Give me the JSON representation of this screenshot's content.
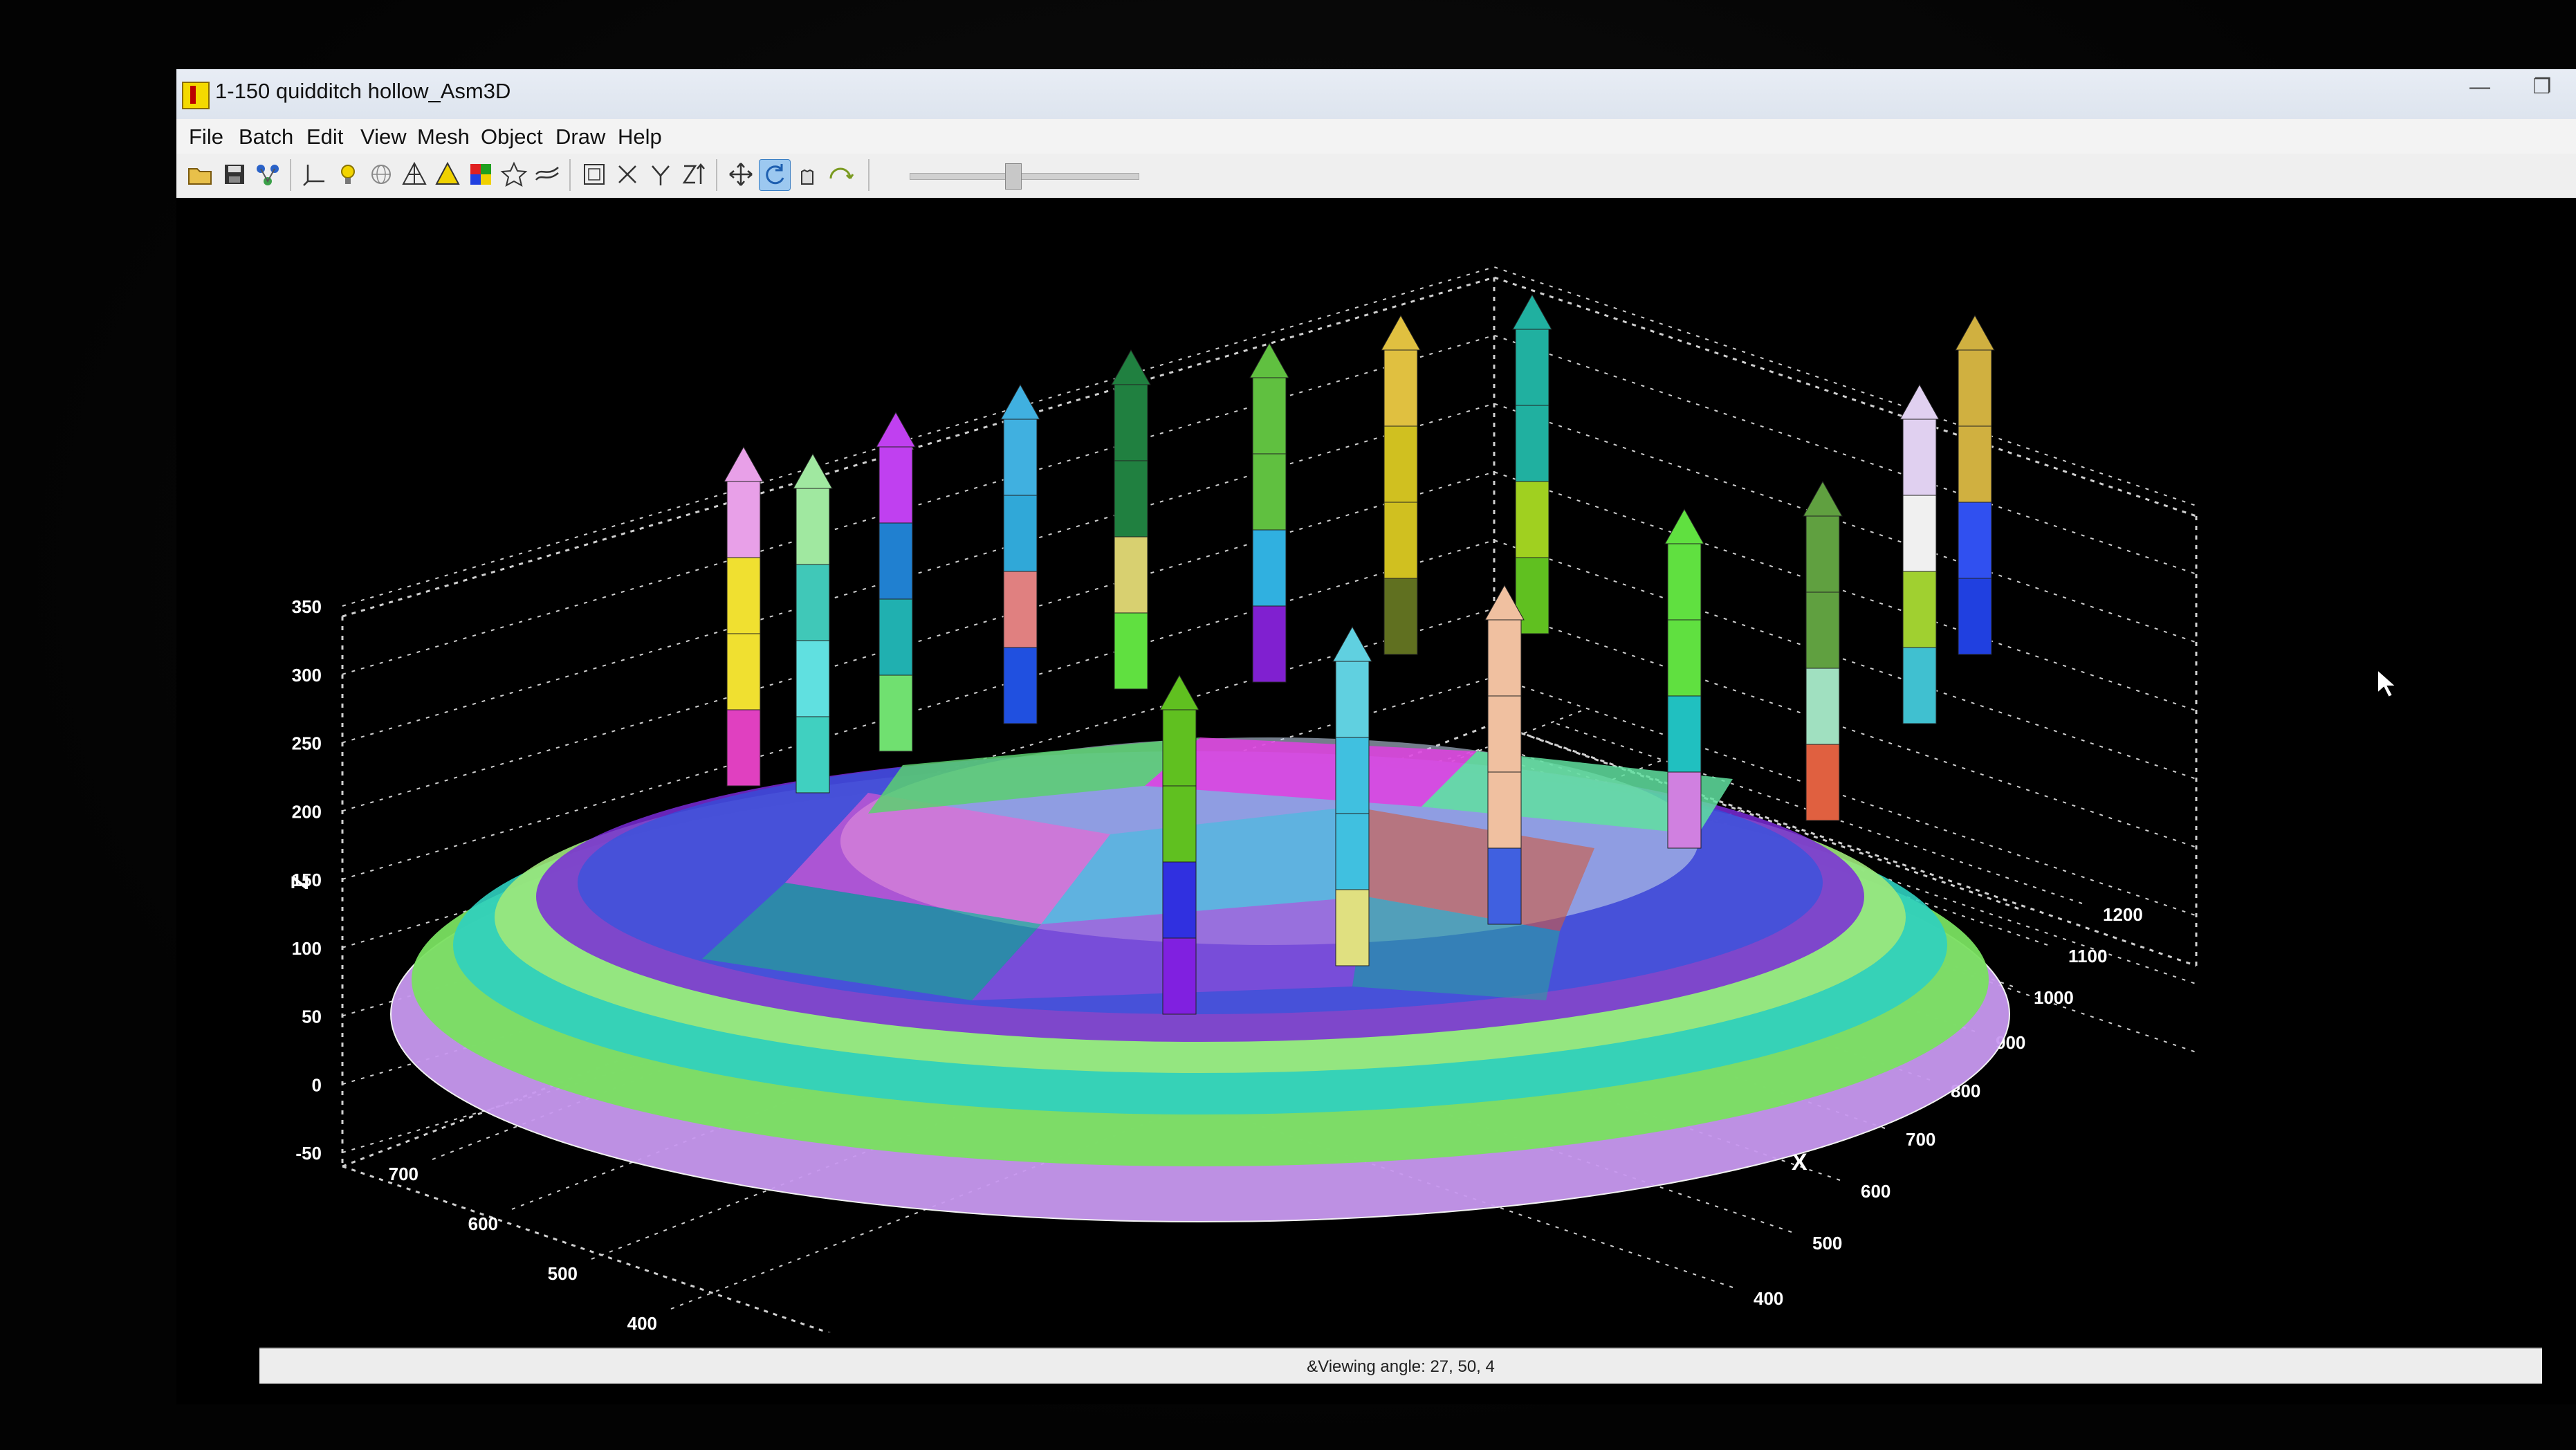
{
  "window": {
    "title": "1-150 quidditch hollow_Asm3D",
    "minimize_glyph": "—",
    "restore_glyph": "❐"
  },
  "menu": {
    "items": [
      "File",
      "Batch",
      "Edit",
      "View",
      "Mesh",
      "Object",
      "Draw",
      "Help"
    ]
  },
  "toolbar": {
    "buttons": [
      "open-folder-icon",
      "save-icon",
      "network-icon",
      "axes-icon",
      "lightbulb-icon",
      "mesh-sphere-icon",
      "wireframe-pyramid-icon",
      "solid-pyramid-icon",
      "color-palette-icon",
      "star-icon",
      "contour-lines-icon",
      "bounding-box-icon",
      "view-x-icon",
      "view-y-icon",
      "view-z-icon",
      "move-icon",
      "rotate-icon",
      "pan-icon",
      "reset-view-icon"
    ],
    "active_button": "rotate-icon",
    "slider_value": 0.45
  },
  "chart_data": {
    "type": "surface-3d",
    "axes": {
      "z": {
        "title": "Z",
        "ticks": [
          "350",
          "300",
          "250",
          "200",
          "150",
          "100",
          "50",
          "0",
          "-50"
        ]
      },
      "y": {
        "title": "",
        "ticks": [
          "700",
          "600",
          "500",
          "400"
        ]
      },
      "x": {
        "title": "X",
        "ticks": [
          "1200",
          "1100",
          "1000",
          "900",
          "800",
          "700",
          "600",
          "500",
          "400"
        ]
      }
    },
    "grid": true
  },
  "status": {
    "text": "&Viewing angle: 27, 50, 4"
  },
  "colors": {
    "background": "#000000",
    "grid": "#d8d8d8",
    "active_tool": "#5aa0e0"
  }
}
